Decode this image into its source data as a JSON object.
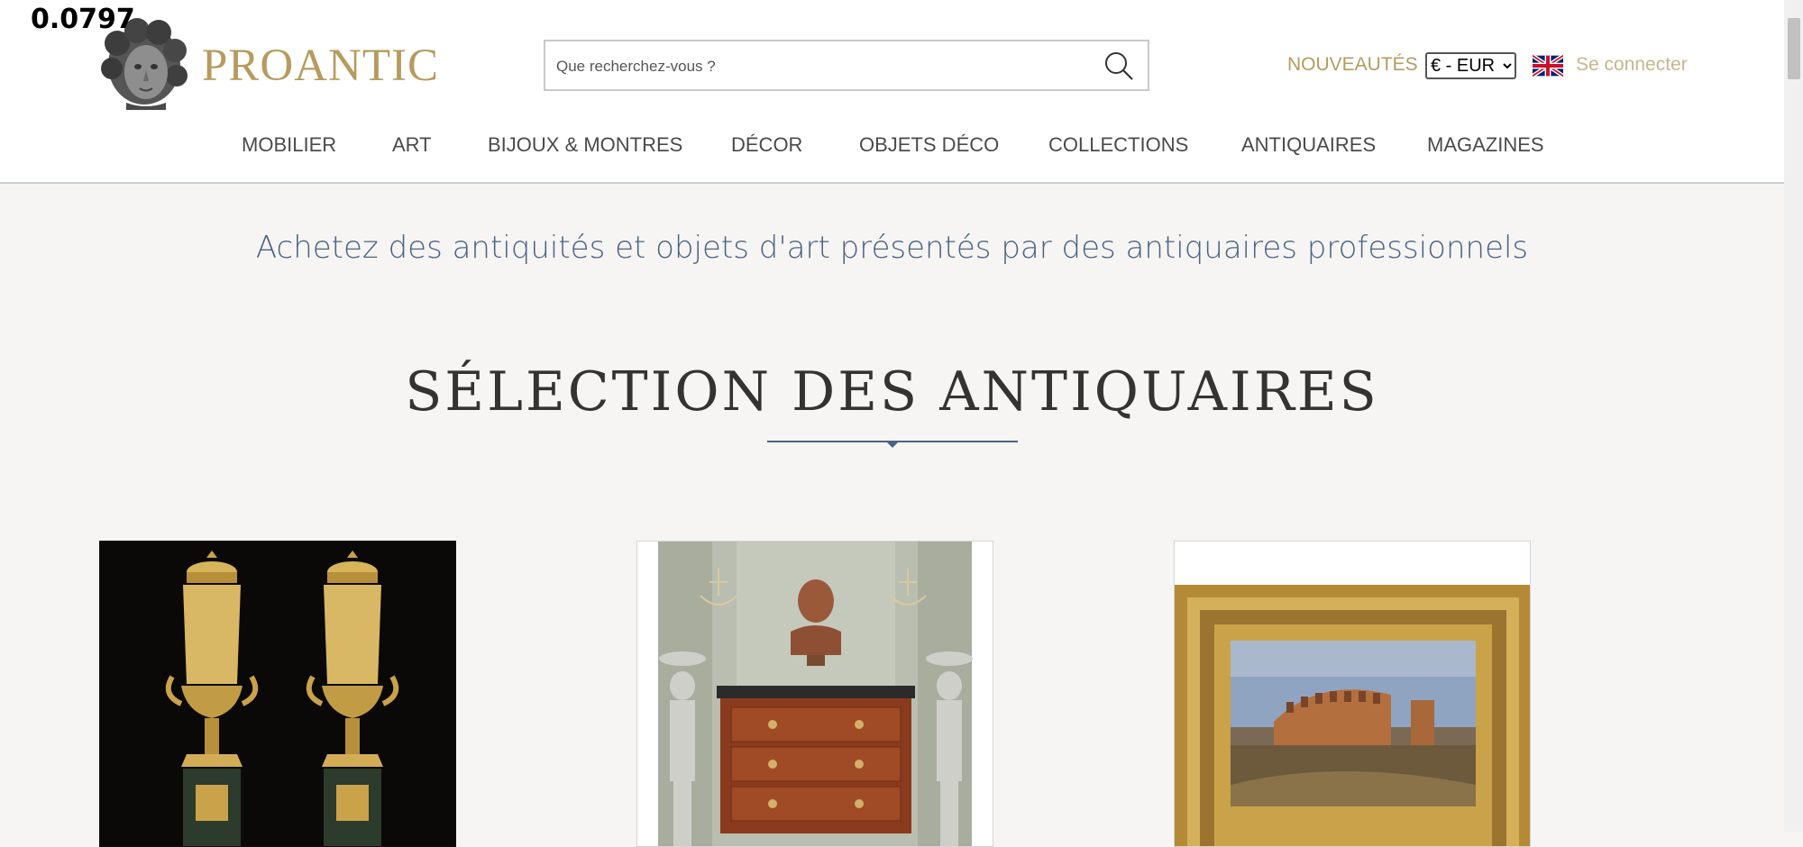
{
  "overlay": {
    "value": "0.0797"
  },
  "header": {
    "logo_text": "PROANTIC",
    "search": {
      "placeholder": "Que recherchez-vous ?"
    },
    "nouveautes": "NOUVEAUTÉS",
    "currency": {
      "selected": "€ - EUR"
    },
    "language_flag": "uk-flag-icon",
    "login": "Se connecter"
  },
  "nav": {
    "items": [
      {
        "label": "MOBILIER"
      },
      {
        "label": "ART"
      },
      {
        "label": "BIJOUX & MONTRES"
      },
      {
        "label": "DÉCOR"
      },
      {
        "label": "OBJETS DÉCO"
      },
      {
        "label": "COLLECTIONS"
      },
      {
        "label": "ANTIQUAIRES"
      },
      {
        "label": "MAGAZINES"
      }
    ]
  },
  "main": {
    "tagline": "Achetez des antiquités et objets d'art présentés par des antiquaires professionnels",
    "section_title": "SÉLECTION DES ANTIQUAIRES",
    "cards": [
      {
        "image": "gilt-bronze-urns-image"
      },
      {
        "image": "commode-with-bust-image"
      },
      {
        "image": "colosseum-painting-image"
      }
    ]
  },
  "colors": {
    "gold": "#b69b5e",
    "tagline_blue": "#4a6283",
    "background": "#f6f5f3"
  }
}
